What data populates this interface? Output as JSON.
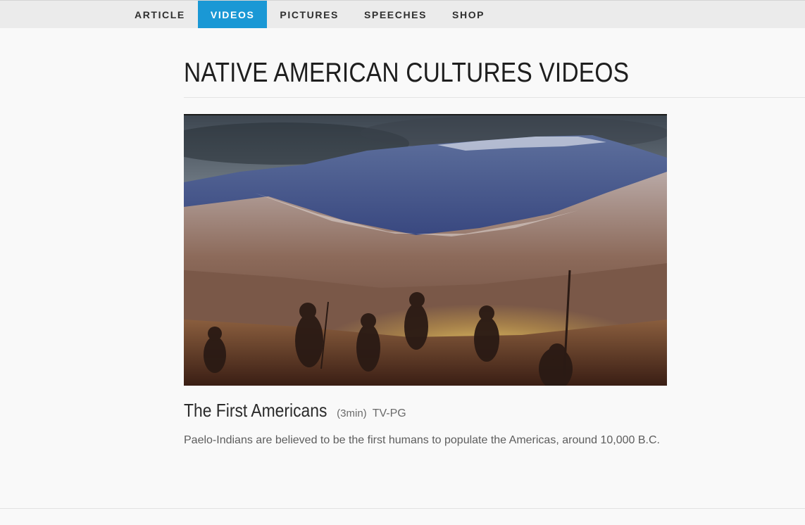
{
  "nav": {
    "items": [
      {
        "label": "ARTICLE",
        "active": false
      },
      {
        "label": "VIDEOS",
        "active": true
      },
      {
        "label": "PICTURES",
        "active": false
      },
      {
        "label": "SPEECHES",
        "active": false
      },
      {
        "label": "SHOP",
        "active": false
      }
    ]
  },
  "page": {
    "title": "NATIVE AMERICAN CULTURES VIDEOS"
  },
  "video": {
    "title": "The First Americans",
    "duration": "(3min)",
    "rating": "TV-PG",
    "description": "Paelo-Indians are believed to be the first humans to populate the Americas, around 10,000 B.C."
  },
  "colors": {
    "accent": "#1a98d5",
    "nav_background": "#ebebeb",
    "page_background": "#f9f9f9"
  }
}
